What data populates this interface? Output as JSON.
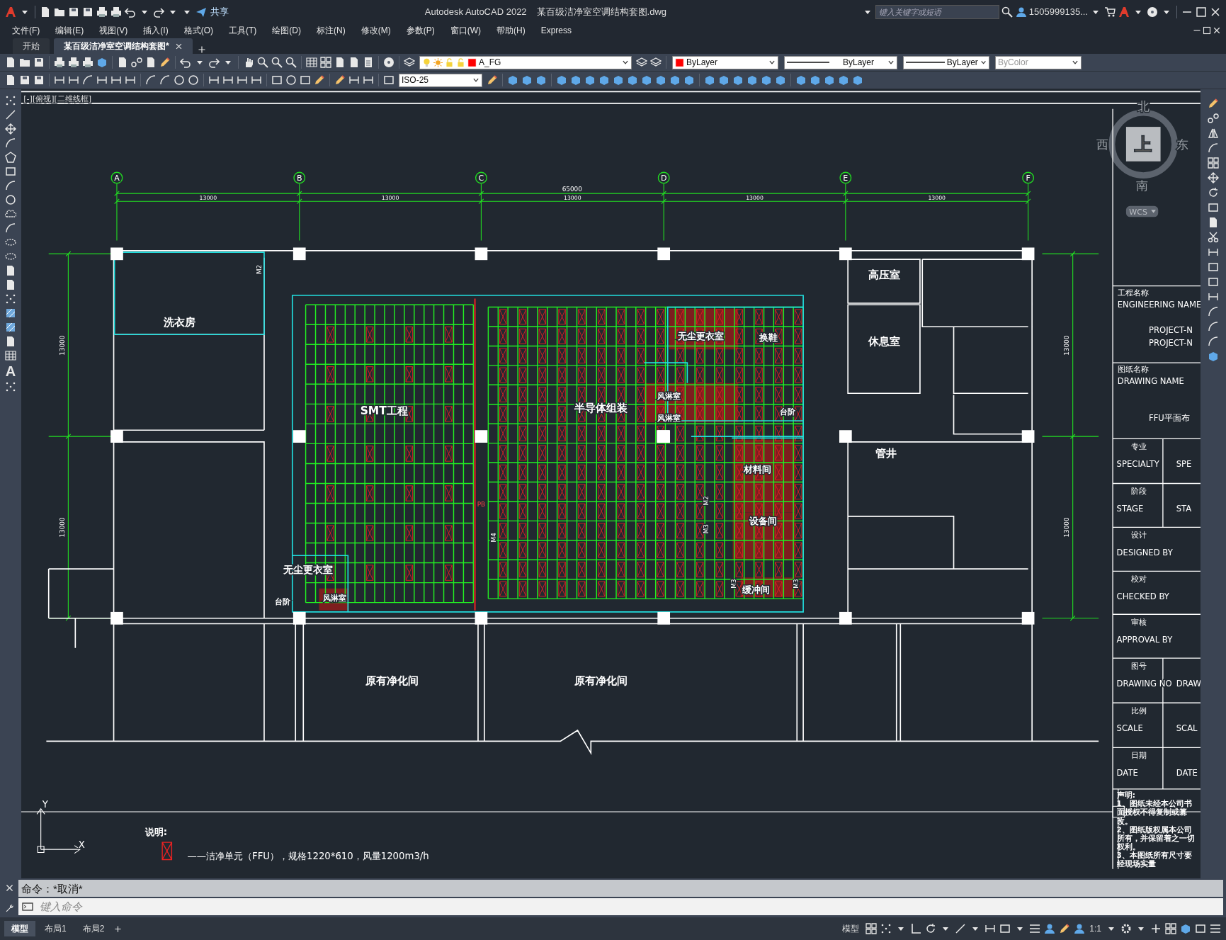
{
  "title_bar": {
    "app_title": "Autodesk AutoCAD 2022",
    "file_name": "某百级洁净室空调结构套图.dwg",
    "share_label": "共享",
    "search_placeholder": "键入关键字或短语",
    "user_name": "1505999135..."
  },
  "menu": [
    "文件(F)",
    "编辑(E)",
    "视图(V)",
    "插入(I)",
    "格式(O)",
    "工具(T)",
    "绘图(D)",
    "标注(N)",
    "修改(M)",
    "参数(P)",
    "窗口(W)",
    "帮助(H)",
    "Express"
  ],
  "file_tabs": [
    {
      "label": "开始",
      "selected": false
    },
    {
      "label": "某百级洁净室空调结构套图*",
      "selected": true
    }
  ],
  "properties_toolbar": {
    "layer": "A_FG",
    "color_setting": "ByLayer",
    "linetype": "ByLayer",
    "lineweight": "ByLayer",
    "plot_style": "ByColor",
    "plot_style_disabled": true,
    "dim_style": "ISO-25"
  },
  "left_toolbar": {
    "text_tool": "A"
  },
  "viewport_label": "[-][俯视][二维线框]",
  "viewcube": {
    "north": "北",
    "south": "南",
    "east": "东",
    "west": "西",
    "face": "上",
    "coordinate_system": "WCS"
  },
  "drawing": {
    "axes": [
      "A",
      "B",
      "C",
      "D",
      "E",
      "F"
    ],
    "overall_dimension": "65000",
    "bay_dimensions": [
      "13000",
      "13000",
      "13000",
      "13000",
      "13000"
    ],
    "left_dimensions": [
      "13000",
      "13000"
    ],
    "right_dimensions": [
      "13000",
      "13000"
    ],
    "rooms": [
      "洗衣房",
      "SMT工程",
      "半导体组装",
      "无尘更衣室",
      "换鞋",
      "风淋室",
      "风淋室",
      "台阶",
      "材料间",
      "设备间",
      "缓冲间",
      "高压室",
      "休息室",
      "管井",
      "无尘更衣室",
      "风淋室",
      "台阶",
      "原有净化间",
      "原有净化间"
    ],
    "door_tags": [
      "M2",
      "M4",
      "M2",
      "M3",
      "M3",
      "M3",
      "PB"
    ],
    "ucs": {
      "x": "X",
      "y": "Y"
    },
    "legend": {
      "title": "说明:",
      "text": "——洁净单元（FFU），规格1220*610，风量1200m3/h"
    }
  },
  "title_block": {
    "rows": [
      {
        "kind": "wide",
        "label_cn": "工程名称",
        "label_en": "ENGINEERING NAME",
        "values": [
          "PROJECT-N",
          "PROJECT-N"
        ]
      },
      {
        "kind": "wide",
        "label_cn": "图纸名称",
        "label_en": "DRAWING NAME",
        "values": [
          "FFU平面布"
        ]
      },
      {
        "kind": "split",
        "label_cn": "专业",
        "label_en": "SPECIALTY",
        "values": [
          "SPE"
        ]
      },
      {
        "kind": "split",
        "label_cn": "阶段",
        "label_en": "STAGE",
        "values": [
          "STA"
        ]
      },
      {
        "kind": "label",
        "label_cn": "设计",
        "label_en": "DESIGNED BY",
        "values": []
      },
      {
        "kind": "label",
        "label_cn": "校对",
        "label_en": "CHECKED BY",
        "values": []
      },
      {
        "kind": "label",
        "label_cn": "审核",
        "label_en": "APPROVAL BY",
        "values": []
      },
      {
        "kind": "split",
        "label_cn": "图号",
        "label_en": "DRAWING NO",
        "values": [
          "DRAW"
        ]
      },
      {
        "kind": "split",
        "label_cn": "比例",
        "label_en": "SCALE",
        "values": [
          "SCAL"
        ]
      },
      {
        "kind": "split",
        "label_cn": "日期",
        "label_en": "DATE",
        "values": [
          "DATE"
        ]
      }
    ],
    "notes_title": "声明:",
    "notes": [
      "1、图纸未经本公司书面授权不得复制或篡改。",
      "2、图纸版权属本公司所有，并保留着之一切权利。",
      "3、本图纸所有尺寸要经现场实量"
    ]
  },
  "command_line": {
    "history": "命令：*取消*",
    "placeholder": "键入命令"
  },
  "layout_tabs": [
    {
      "label": "模型",
      "selected": true
    },
    {
      "label": "布局1",
      "selected": false
    },
    {
      "label": "布局2",
      "selected": false
    }
  ],
  "status_bar": {
    "space": "模型",
    "annotation_scale": "1:1"
  }
}
